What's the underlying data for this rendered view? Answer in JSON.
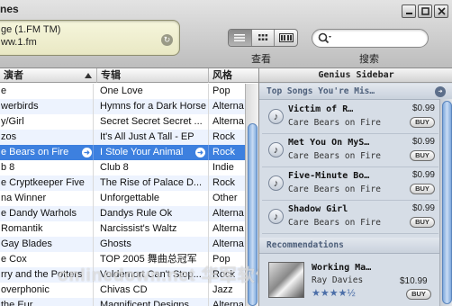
{
  "toolbar": {
    "app_title": "nes",
    "lcd_line1": "ge (1.FM TM)",
    "lcd_line2": "ww.1.fm",
    "view_label": "查看",
    "search_label": "搜索",
    "search_value": ""
  },
  "list": {
    "headers": {
      "artist": "演者",
      "album": "专辑",
      "genre": "风格"
    },
    "rows": [
      {
        "artist": "e",
        "album": "One Love",
        "genre": "Pop"
      },
      {
        "artist": "werbirds",
        "album": "Hymns for a Dark Horse",
        "genre": "Alterna"
      },
      {
        "artist": "y/Girl",
        "album": "Secret Secret Secret ...",
        "genre": "Alterna"
      },
      {
        "artist": "zos",
        "album": "It's All Just A Tall - EP",
        "genre": "Rock"
      },
      {
        "artist": "e Bears on Fire",
        "album": "I Stole Your Animal",
        "genre": "Rock"
      },
      {
        "artist": "b 8",
        "album": "Club 8",
        "genre": "Indie"
      },
      {
        "artist": "e Cryptkeeper Five",
        "album": "The Rise of Palace D...",
        "genre": "Rock"
      },
      {
        "artist": "na Winner",
        "album": "Unforgettable",
        "genre": "Other"
      },
      {
        "artist": "e Dandy Warhols",
        "album": "Dandys Rule Ok",
        "genre": "Alterna"
      },
      {
        "artist": "Romantik",
        "album": "Narcissist's Waltz",
        "genre": "Alterna"
      },
      {
        "artist": "Gay Blades",
        "album": "Ghosts",
        "genre": "Alterna"
      },
      {
        "artist": "e Cox",
        "album": "TOP 2005 舞曲总冠军",
        "genre": "Pop"
      },
      {
        "artist": "rry and the Potters",
        "album": "Voldemort Can't Stop...",
        "genre": "Rock"
      },
      {
        "artist": "overphonic",
        "album": "Chivas CD",
        "genre": "Jazz"
      },
      {
        "artist": "the Eur",
        "album": "Magnificent Designs",
        "genre": "Alterna"
      }
    ]
  },
  "watermark": "onlinedown.net 华军软件园",
  "sidebar": {
    "title": "Genius Sidebar",
    "top_songs_title": "Top Songs You're Mis…",
    "top_songs": [
      {
        "song": "Victim of R…",
        "artist": "Care Bears on Fire",
        "price": "$0.99",
        "buy": "BUY"
      },
      {
        "song": "Met You On MyS…",
        "artist": "Care Bears on Fire",
        "price": "$0.99",
        "buy": "BUY"
      },
      {
        "song": "Five-Minute Bo…",
        "artist": "Care Bears on Fire",
        "price": "$0.99",
        "buy": "BUY"
      },
      {
        "song": "Shadow Girl",
        "artist": "Care Bears on Fire",
        "price": "$0.99",
        "buy": "BUY"
      }
    ],
    "recommendations_title": "Recommendations",
    "recommendation": {
      "title": "Working Ma…",
      "artist": "Ray Davies",
      "stars": "★★★★½",
      "rating": 4.5,
      "price": "$10.99",
      "buy": "BUY"
    }
  },
  "colors": {
    "selection": "#3d80df",
    "row_alt": "#edf3fe",
    "sidebar_bg": "#d6dde6"
  }
}
